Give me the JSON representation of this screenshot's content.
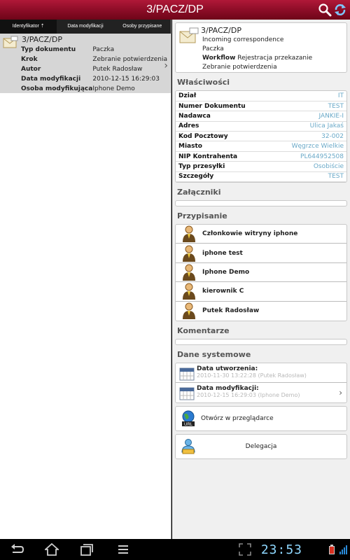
{
  "app": {
    "title": "3/PACZ/DP"
  },
  "tabs": [
    {
      "label": "Identyfikator ⇡",
      "active": true
    },
    {
      "label": "Data modyfikacji",
      "active": false
    },
    {
      "label": "Osoby przypisane",
      "active": false
    }
  ],
  "document": {
    "title": "3/PACZ/DP",
    "fields": [
      {
        "key": "Typ dokumentu",
        "value": "Paczka"
      },
      {
        "key": "Krok",
        "value": "Zebranie potwierdzenia"
      },
      {
        "key": "Autor",
        "value": "Putek Radosław"
      },
      {
        "key": "Data modyfikacji",
        "value": "2010-12-15 16:29:03"
      },
      {
        "key": "Osoba modyfikująca",
        "value": "Iphone Demo"
      }
    ]
  },
  "header": {
    "title": "3/PACZ/DP",
    "line1": "Incoming correspondence",
    "line2": "Paczka",
    "workflow_label": "Workflow",
    "workflow_value": "Rejestracja przekazanie",
    "line4": "Zebranie potwierdzenia"
  },
  "sections": {
    "properties": "Właściwości",
    "attachments": "Załączniki",
    "assignment": "Przypisanie",
    "comments": "Komentarze",
    "system": "Dane systemowe"
  },
  "properties": [
    {
      "key": "Dział",
      "value": "IT"
    },
    {
      "key": "Numer Dokumentu",
      "value": "TEST"
    },
    {
      "key": "Nadawca",
      "value": "JANKIE-I"
    },
    {
      "key": "Adres",
      "value": "Ulica Jakaś"
    },
    {
      "key": "Kod Pocztowy",
      "value": "32-002"
    },
    {
      "key": "Miasto",
      "value": "Węgrzce Wielkie"
    },
    {
      "key": "NIP Kontrahenta",
      "value": "PL644952508"
    },
    {
      "key": "Typ przesyłki",
      "value": "Osobiście"
    },
    {
      "key": "Szczegóły",
      "value": "TEST"
    }
  ],
  "assignees": [
    "Członkowie witryny iphone",
    "iphone test",
    "Iphone Demo",
    "kierownik C",
    "Putek Radosław"
  ],
  "system": {
    "created_label": "Data utworzenia:",
    "created_value": "2010-11-30 13:22:28 (Putek Radosław)",
    "modified_label": "Data modyfikacji:",
    "modified_value": "2010-12-15 16:29:03 (Iphone Demo)"
  },
  "actions": {
    "open_browser": "Otwórz w przeglądarce",
    "delegation": "Delegacja",
    "url_badge": "URL"
  },
  "statusbar": {
    "clock": "23:53"
  },
  "colors": {
    "titlebar": "#8a0c26",
    "value_blue": "#6aa9c8",
    "clock": "#8fd8ff"
  }
}
